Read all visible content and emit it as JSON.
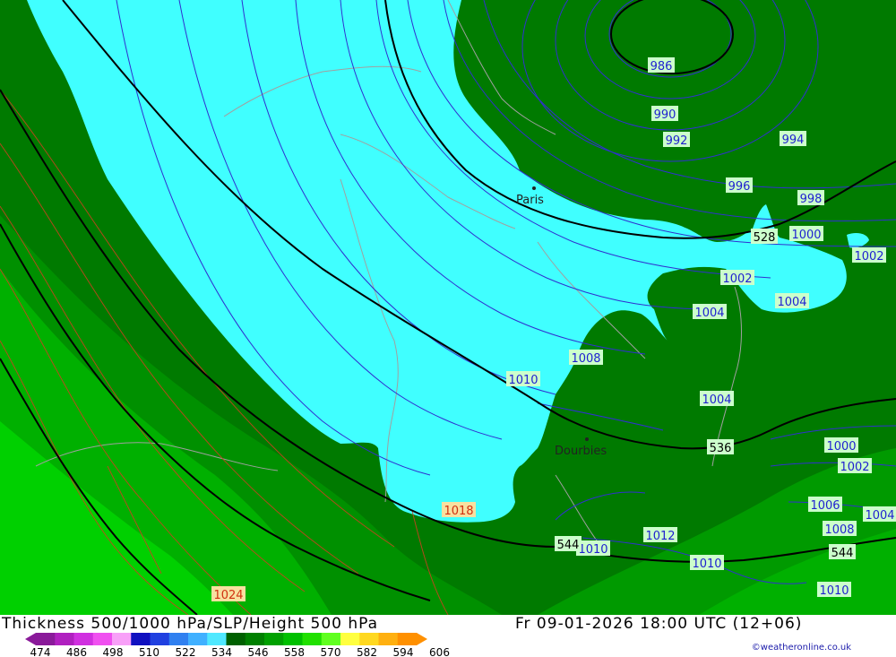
{
  "footer": {
    "title": "Thickness 500/1000 hPa/SLP/Height 500 hPa",
    "valid_time": "Fr 09-01-2026 18:00 UTC (12+06)",
    "credit": "©weatheronline.co.uk"
  },
  "legend": {
    "ticks": [
      "474",
      "486",
      "498",
      "510",
      "522",
      "534",
      "546",
      "558",
      "570",
      "582",
      "594",
      "606"
    ],
    "colors": [
      "#8a1a9a",
      "#b020c0",
      "#d030e0",
      "#f050f0",
      "#f8a0f8",
      "#1010c0",
      "#2040e0",
      "#3080f0",
      "#40b0ff",
      "#50e8ff",
      "#006000",
      "#008000",
      "#00a000",
      "#00c000",
      "#20e000",
      "#60ff20",
      "#ffff40",
      "#ffd820",
      "#ffb010",
      "#ff9000"
    ]
  },
  "colors": {
    "cyan_band": "#40ffff",
    "dark_green": "#007a00",
    "mid_green": "#009000",
    "light_green": "#00b800",
    "bright_green": "#00d800",
    "slp_isobar": "#3030d0",
    "border_line": "#a0a0a0"
  },
  "cities": [
    {
      "name": "Paris"
    },
    {
      "name": "Dourbies"
    }
  ],
  "slp_labels": [
    "986",
    "990",
    "992",
    "994",
    "996",
    "998",
    "1000",
    "1002",
    "1002",
    "1004",
    "1004",
    "1008",
    "1010",
    "1004",
    "1000",
    "1002",
    "1006",
    "1008",
    "1010",
    "1010",
    "1012",
    "1010",
    "1018",
    "1024",
    "1004"
  ],
  "height_labels": [
    "528",
    "536",
    "544",
    "544"
  ]
}
